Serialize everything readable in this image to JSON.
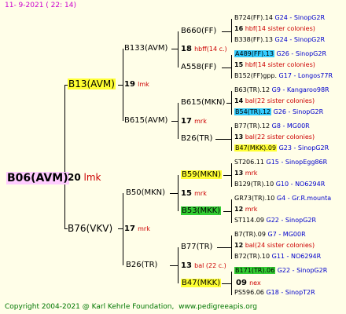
{
  "header": {
    "date": "11-  9-2021  (  22:  14)"
  },
  "footer": {
    "copyright": "Copyright 2004-2021 @ Karl Kehrle Foundation",
    "site": "www.pedigreeapis.org"
  },
  "root": {
    "name": "B06(AVM)",
    "num": "20",
    "code": "lmk"
  },
  "gen1": [
    {
      "name": "B13(AVM)",
      "num": "19",
      "code": "lmk"
    },
    {
      "name": "B76(VKV)",
      "num": "17",
      "code": "mrk"
    }
  ],
  "gen2": [
    {
      "name": "B133(AVM)",
      "num": "18",
      "code": "hbff(14 c.)"
    },
    {
      "name": "B615(AVM)",
      "num": "17",
      "code": "mrk"
    },
    {
      "name": "B50(MKN)",
      "num": "15",
      "code": "mrk"
    },
    {
      "name": "B26(TR)",
      "num": "13",
      "code": "bal (22 c.)"
    }
  ],
  "gen3": [
    {
      "name": "B660(FF)",
      "num": "18",
      "code": "hbff(14 c.)"
    },
    {
      "name": "A558(FF)"
    },
    {
      "name": "B615(MKN)",
      "num": "17",
      "code": "mrk"
    },
    {
      "name": "B26(TR)"
    },
    {
      "name": "B59(MKN)",
      "num": "15",
      "code": "mrk"
    },
    {
      "name": "B53(MKK)"
    },
    {
      "name": "B77(TR)",
      "num": "13",
      "code": "bal (22 c.)"
    },
    {
      "name": "B47(MKK)",
      "num": "09",
      "code": "nex"
    }
  ],
  "gen4": [
    {
      "name": "B724(FF).14",
      "loc": "G24 - SinopG2R",
      "num": "16",
      "code": "hbf(14 sister colonies)"
    },
    {
      "name": "B338(FF).13",
      "loc": "G24 - SinopG2R"
    },
    {
      "name": "A489(FF).13",
      "loc": "G26 - SinopG2R",
      "num": "15",
      "code": "hbf(14 sister colonies)"
    },
    {
      "name": "B152(FF)gpp.",
      "loc": "G17 - Longos77R"
    },
    {
      "name": "B63(TR).12",
      "loc": "G9 - Kangaroo98R",
      "num": "14",
      "code": "bal(22 sister colonies)"
    },
    {
      "name": "B54(TR).12",
      "loc": "G26 - SinopG2R"
    },
    {
      "name": "B77(TR).12",
      "loc": "G8 - MG00R",
      "num": "13",
      "code": "bal(22 sister colonies)"
    },
    {
      "name": "B47(MKK).09",
      "loc": "G23 - SinopG2R"
    },
    {
      "name": "ST206.11",
      "loc": "G15 - SinopEgg86R",
      "num": "13",
      "code": "mrk"
    },
    {
      "name": "B129(TR).10",
      "loc": "G10 - NO6294R"
    },
    {
      "name": "GR73(TR).10",
      "loc": "G4 - Gr.R.mounta",
      "num": "12",
      "code": "mrk"
    },
    {
      "name": "ST114.09",
      "loc": "G22 - SinopG2R"
    },
    {
      "name": "B7(TR).09",
      "loc": "G7 - MG00R",
      "num": "12",
      "code": "bal(24 sister colonies)"
    },
    {
      "name": "B72(TR).10",
      "loc": "G11 - NO6294R"
    },
    {
      "name": "B171(TR).06",
      "loc": "G22 - SinopG2R",
      "num": "09",
      "code": "nex"
    },
    {
      "name": "PS596.06",
      "loc": "G18 - SinopT2R"
    }
  ]
}
